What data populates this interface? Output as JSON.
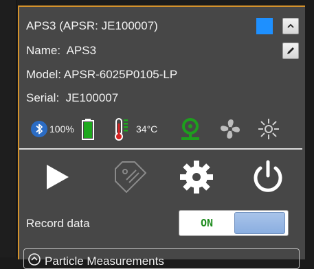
{
  "device": {
    "title": "APS3 (APSR: JE100007)",
    "name_label": "Name:",
    "name_value": "APS3",
    "model": "Model: APSR-6025P0105-LP",
    "serial_label": "Serial:",
    "serial_value": "JE100007",
    "swatch_color": "#1e90ff"
  },
  "status": {
    "battery_percent": "100%",
    "battery_level": 1.0,
    "temperature": "34°C",
    "bluetooth_icon": "bluetooth-icon",
    "battery_icon": "battery-icon",
    "thermometer_icon": "thermometer-icon",
    "sensor_icon": "laser-sensor-icon",
    "fan_icon": "fan-icon",
    "light_icon": "light-icon"
  },
  "controls": {
    "play_icon": "play-icon",
    "tag_icon": "tag-icon",
    "settings_icon": "gear-icon",
    "power_icon": "power-icon"
  },
  "record": {
    "label": "Record data",
    "toggle_text": "ON",
    "state": "on"
  },
  "section": {
    "label": "Particle Measurements"
  },
  "colors": {
    "accent_border": "#d4922c",
    "green": "#1e9e1e",
    "panel": "#474747"
  }
}
